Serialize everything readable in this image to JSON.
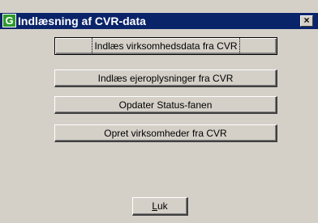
{
  "window": {
    "title": "Indlæsning af CVR-data",
    "icon_letter": "G",
    "close_symbol": "×"
  },
  "buttons": {
    "load_company_data": "Indlæs virksomhedsdata fra CVR",
    "load_owner_info": "Indlæs ejeroplysninger fra CVR",
    "update_status_tab": "Opdater Status-fanen",
    "create_companies": "Opret virksomheder fra CVR",
    "close_mnemonic": "L",
    "close_rest": "uk"
  },
  "colors": {
    "titlebar": "#0a246a",
    "face": "#d4d0c8",
    "icon": "#2e9a2e"
  }
}
